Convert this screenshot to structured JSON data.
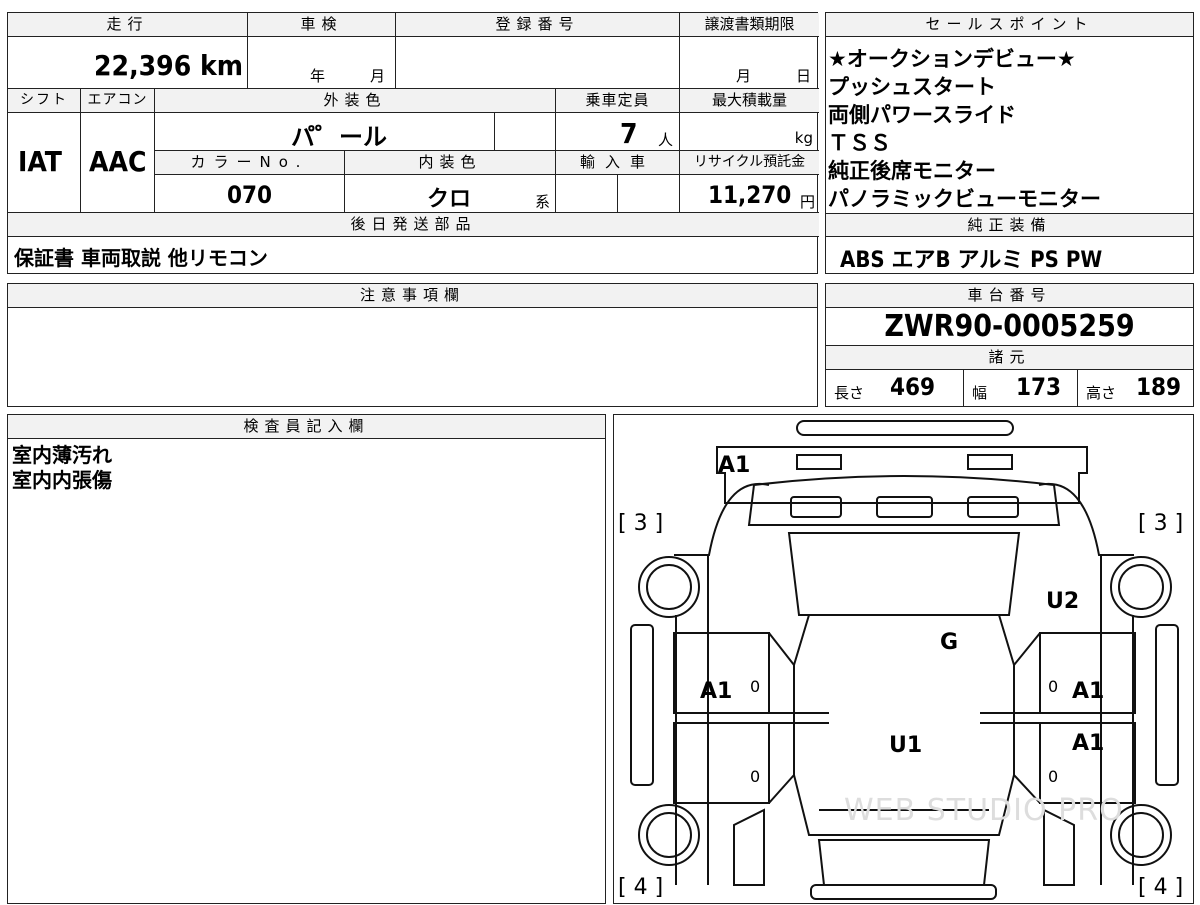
{
  "top": {
    "mileage_label": "走行",
    "mileage_value": "22,396 km",
    "inspection_label": "車検",
    "inspection_year": "年",
    "inspection_month": "月",
    "registration_label": "登録番号",
    "transfer_label": "譲渡書類期限",
    "transfer_month": "月",
    "transfer_day": "日"
  },
  "row2": {
    "shift_label": "シフト",
    "shift_value": "IAT",
    "ac_label": "エアコン",
    "ac_value": "AAC",
    "exterior_label": "外装色",
    "exterior_value": "パ゜ール",
    "capacity_label": "乗車定員",
    "capacity_value": "7",
    "capacity_unit": "人",
    "load_label": "最大積載量",
    "load_unit": "kg",
    "color_no_label": "カラーNo.",
    "color_no_value": "070",
    "interior_label": "内装色",
    "interior_value": "クロ",
    "interior_suffix": "系",
    "import_label": "輸入車",
    "recycle_label": "リサイクル預託金",
    "recycle_value": "11,270",
    "recycle_unit": "円"
  },
  "later": {
    "label": "後日発送部品",
    "value": "保証書 車両取説 他リモコン"
  },
  "sales": {
    "label": "セールスポイント",
    "lines": [
      "★オークションデビュー★",
      "プッシュスタート",
      "両側パワースライド",
      "ＴＳＳ",
      "純正後席モニター",
      "パノラミックビューモニター"
    ]
  },
  "equipment": {
    "label": "純正装備",
    "value": "ABS エアB アルミ PS PW"
  },
  "caution": {
    "label": "注意事項欄"
  },
  "chassis": {
    "label": "車台番号",
    "value": "ZWR90-0005259"
  },
  "specs": {
    "label": "諸元",
    "length_label": "長さ",
    "length_value": "469",
    "width_label": "幅",
    "width_value": "173",
    "height_label": "高さ",
    "height_value": "189"
  },
  "inspector": {
    "label": "検査員記入欄",
    "notes": [
      "室内薄汚れ",
      "室内内張傷"
    ]
  },
  "diagram": {
    "marks": {
      "front_bumper": "A1",
      "left_front_tire": "[ 3 ]",
      "right_front_tire": "[ 3 ]",
      "right_fender": "U2",
      "windshield": "G",
      "left_front_door": "A1",
      "right_front_door": "A1",
      "right_rear_door": "A1",
      "roof": "U1",
      "left_rear_tire": "[ 4 ]",
      "right_rear_tire": "[ 4 ]",
      "door_zero_1": "0",
      "door_zero_2": "0",
      "door_zero_3": "0",
      "door_zero_4": "0"
    },
    "watermark": "WEB STUDIO PRO"
  }
}
